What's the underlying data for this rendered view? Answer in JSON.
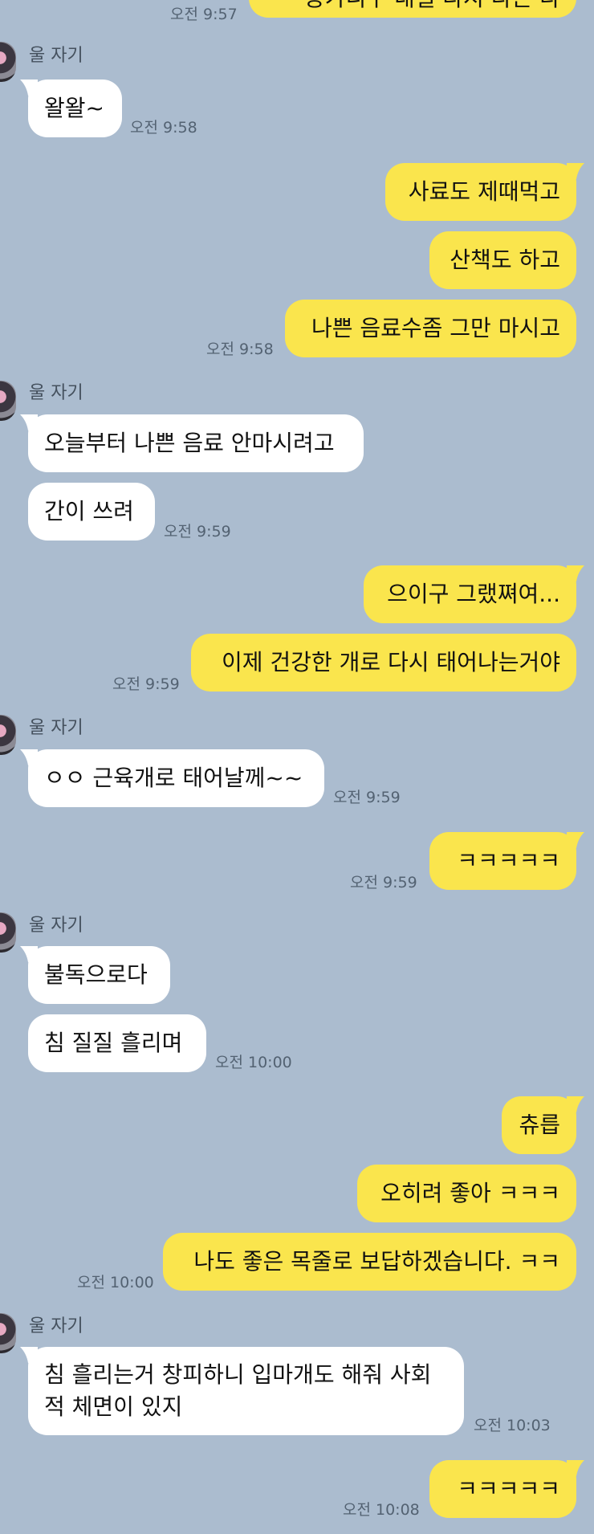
{
  "chat": {
    "sender_name": "울 자기",
    "messages": [
      {
        "from": "me",
        "text": "등가니구 내일 다시 다는 다"
      },
      {
        "from": "me",
        "time": "오전 9:57"
      },
      {
        "from": "partner",
        "text": "왈왈~",
        "time": "오전 9:58"
      },
      {
        "from": "me",
        "text": "사료도 제때먹고"
      },
      {
        "from": "me",
        "text": "산책도 하고"
      },
      {
        "from": "me",
        "text": "나쁜 음료수좀 그만 마시고",
        "time": "오전 9:58"
      },
      {
        "from": "partner",
        "text": "오늘부터 나쁜 음료 안마시려고"
      },
      {
        "from": "partner",
        "text": "간이 쓰려",
        "time": "오전 9:59"
      },
      {
        "from": "me",
        "text": "으이구 그랬쪄여..."
      },
      {
        "from": "me",
        "text": "이제 건강한 개로 다시 태어나는거야",
        "time": "오전 9:59"
      },
      {
        "from": "partner",
        "text": "ㅇㅇ 근육개로 태어날께~~",
        "time": "오전 9:59"
      },
      {
        "from": "me",
        "text": "ㅋㅋㅋㅋㅋ",
        "time": "오전 9:59"
      },
      {
        "from": "partner",
        "text": "불독으로다"
      },
      {
        "from": "partner",
        "text": "침 질질 흘리며",
        "time": "오전 10:00"
      },
      {
        "from": "me",
        "text": "츄릅"
      },
      {
        "from": "me",
        "text": "오히려 좋아 ㅋㅋㅋ"
      },
      {
        "from": "me",
        "text": "나도 좋은 목줄로 보답하겠습니다. ㅋㅋ",
        "time": "오전 10:00"
      },
      {
        "from": "partner",
        "text": "침 흘리는거 창피하니 입마개도 해줘 사회적 체면이 있지",
        "time": "오전 10:03"
      },
      {
        "from": "me",
        "text": "ㅋㅋㅋㅋㅋ",
        "time": "오전 10:08"
      }
    ]
  }
}
